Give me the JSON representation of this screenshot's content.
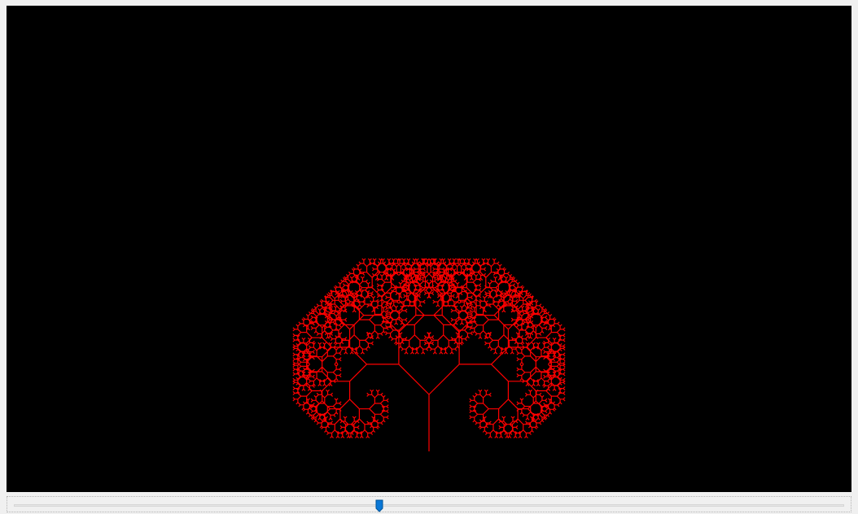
{
  "canvas": {
    "background_color": "#000000",
    "stroke_color": "#ff0000",
    "depth": 12,
    "branch_angle_deg": 45,
    "length_ratio": 0.75
  },
  "slider": {
    "value_fraction": 0.44,
    "accent_color": "#0a78d7"
  }
}
